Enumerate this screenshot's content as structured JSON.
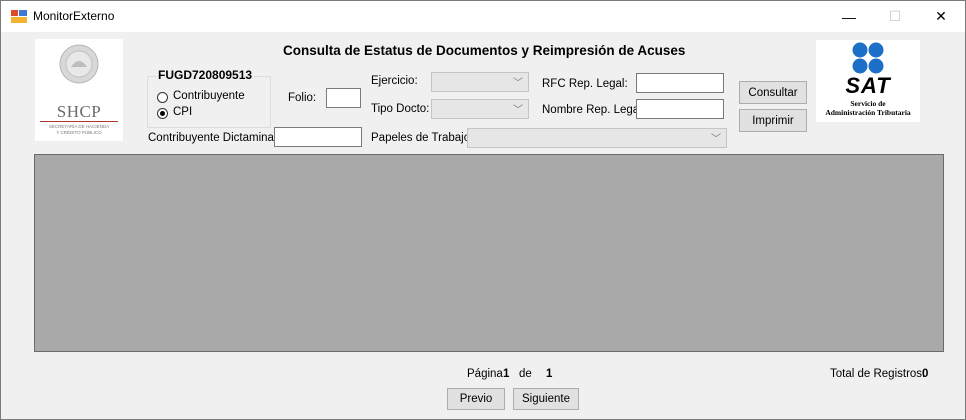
{
  "window": {
    "title": "MonitorExterno",
    "icon": "app-window-icon"
  },
  "title_buttons": {
    "minimize": "—",
    "maximize": "☐",
    "close": "✕"
  },
  "header": {
    "title": "Consulta de Estatus de Documentos y Reimpresión de Acuses"
  },
  "left_logo": {
    "name": "SHCP",
    "subtitle_line1": "SECRETARÍA DE HACIENDA",
    "subtitle_line2": "Y CRÉDITO PÚBLICO"
  },
  "right_logo": {
    "name": "SAT",
    "subtitle_line1": "Servicio de",
    "subtitle_line2": "Administración Tributaria",
    "color": "#1d6fc7"
  },
  "user_group": {
    "rfc": "FUGD720809513",
    "options": [
      {
        "label": "Contribuyente",
        "checked": false
      },
      {
        "label": "CPI",
        "checked": true
      }
    ]
  },
  "form": {
    "folio_label": "Folio:",
    "folio_value": "",
    "ejercicio_label": "Ejercicio:",
    "ejercicio_value": "",
    "tipo_docto_label": "Tipo Docto:",
    "tipo_docto_value": "",
    "rfc_rep_label": "RFC Rep. Legal:",
    "rfc_rep_value": "",
    "nombre_rep_label": "Nombre Rep. Legal:",
    "nombre_rep_value": "",
    "contrib_dict_label": "Contribuyente Dictaminado:",
    "contrib_dict_value": "",
    "papeles_label": "Papeles de Trabajo:",
    "papeles_value": ""
  },
  "buttons": {
    "consultar": "Consultar",
    "imprimir": "Imprimir",
    "previo": "Previo",
    "siguiente": "Siguiente"
  },
  "pagination": {
    "pagina_label": "Página",
    "current": "1",
    "de_label": "de",
    "total_pages": "1"
  },
  "totals": {
    "label": "Total de Registros:",
    "value": "0"
  },
  "colors": {
    "grid_bg": "#a9a9a9",
    "window_bg": "#f0f0f0"
  }
}
